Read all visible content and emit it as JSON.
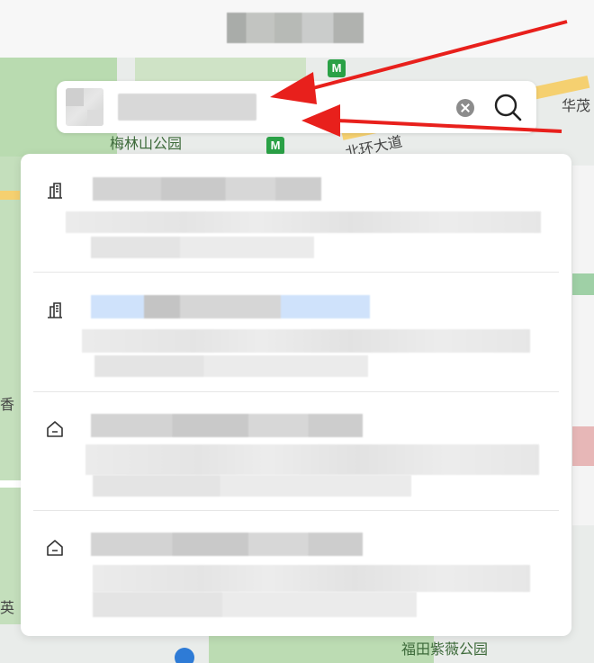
{
  "header": {
    "title": "████████"
  },
  "map": {
    "labels": {
      "park1": "梅林山公园",
      "road1": "北环大道",
      "district": "华茂",
      "left_edge": "香",
      "left_edge2": "英",
      "park2": "福田紫薇公园",
      "metro_icon": "M"
    }
  },
  "search": {
    "query": "██████",
    "clear_icon": "clear-icon",
    "search_icon": "search-icon"
  },
  "results": [
    {
      "type": "building",
      "icon": "building-icon",
      "title": "████████████",
      "address_line1": "█████████████████████████",
      "address_line2": "████████████"
    },
    {
      "type": "building",
      "icon": "building-icon",
      "title": "████████████",
      "address_line1": "█████████████████████████",
      "address_line2": "████████████"
    },
    {
      "type": "residence",
      "icon": "home-icon",
      "title": "████████████",
      "address_line1": "█████████████████████████",
      "address_line2": "████████████"
    },
    {
      "type": "residence",
      "icon": "home-icon",
      "title": "████████████",
      "address_line1": "█████████████████████████",
      "address_line2": "████████████"
    }
  ],
  "colors": {
    "annotation_arrow": "#e8201c",
    "map_green": "#b9dbb0",
    "metro_green": "#2aa146"
  }
}
